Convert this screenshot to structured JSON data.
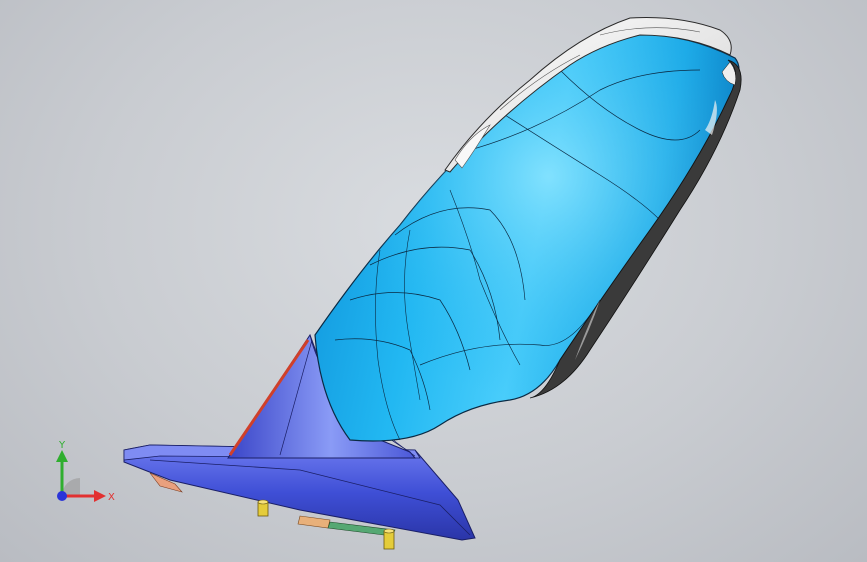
{
  "viewport": {
    "background_color": "#cfd2d6"
  },
  "model": {
    "shell_color": "#1fb2ee",
    "base_color": "#3f4fd6",
    "trim_color": "#eeeeee",
    "edge_color": "#1a1a1a",
    "accent_red": "#d0402a",
    "pin_color": "#e4cc3a"
  },
  "triad": {
    "x_label": "X",
    "y_label": "Y",
    "x_color": "#e23030",
    "y_color": "#2fae2f",
    "z_color": "#2a34d8"
  }
}
